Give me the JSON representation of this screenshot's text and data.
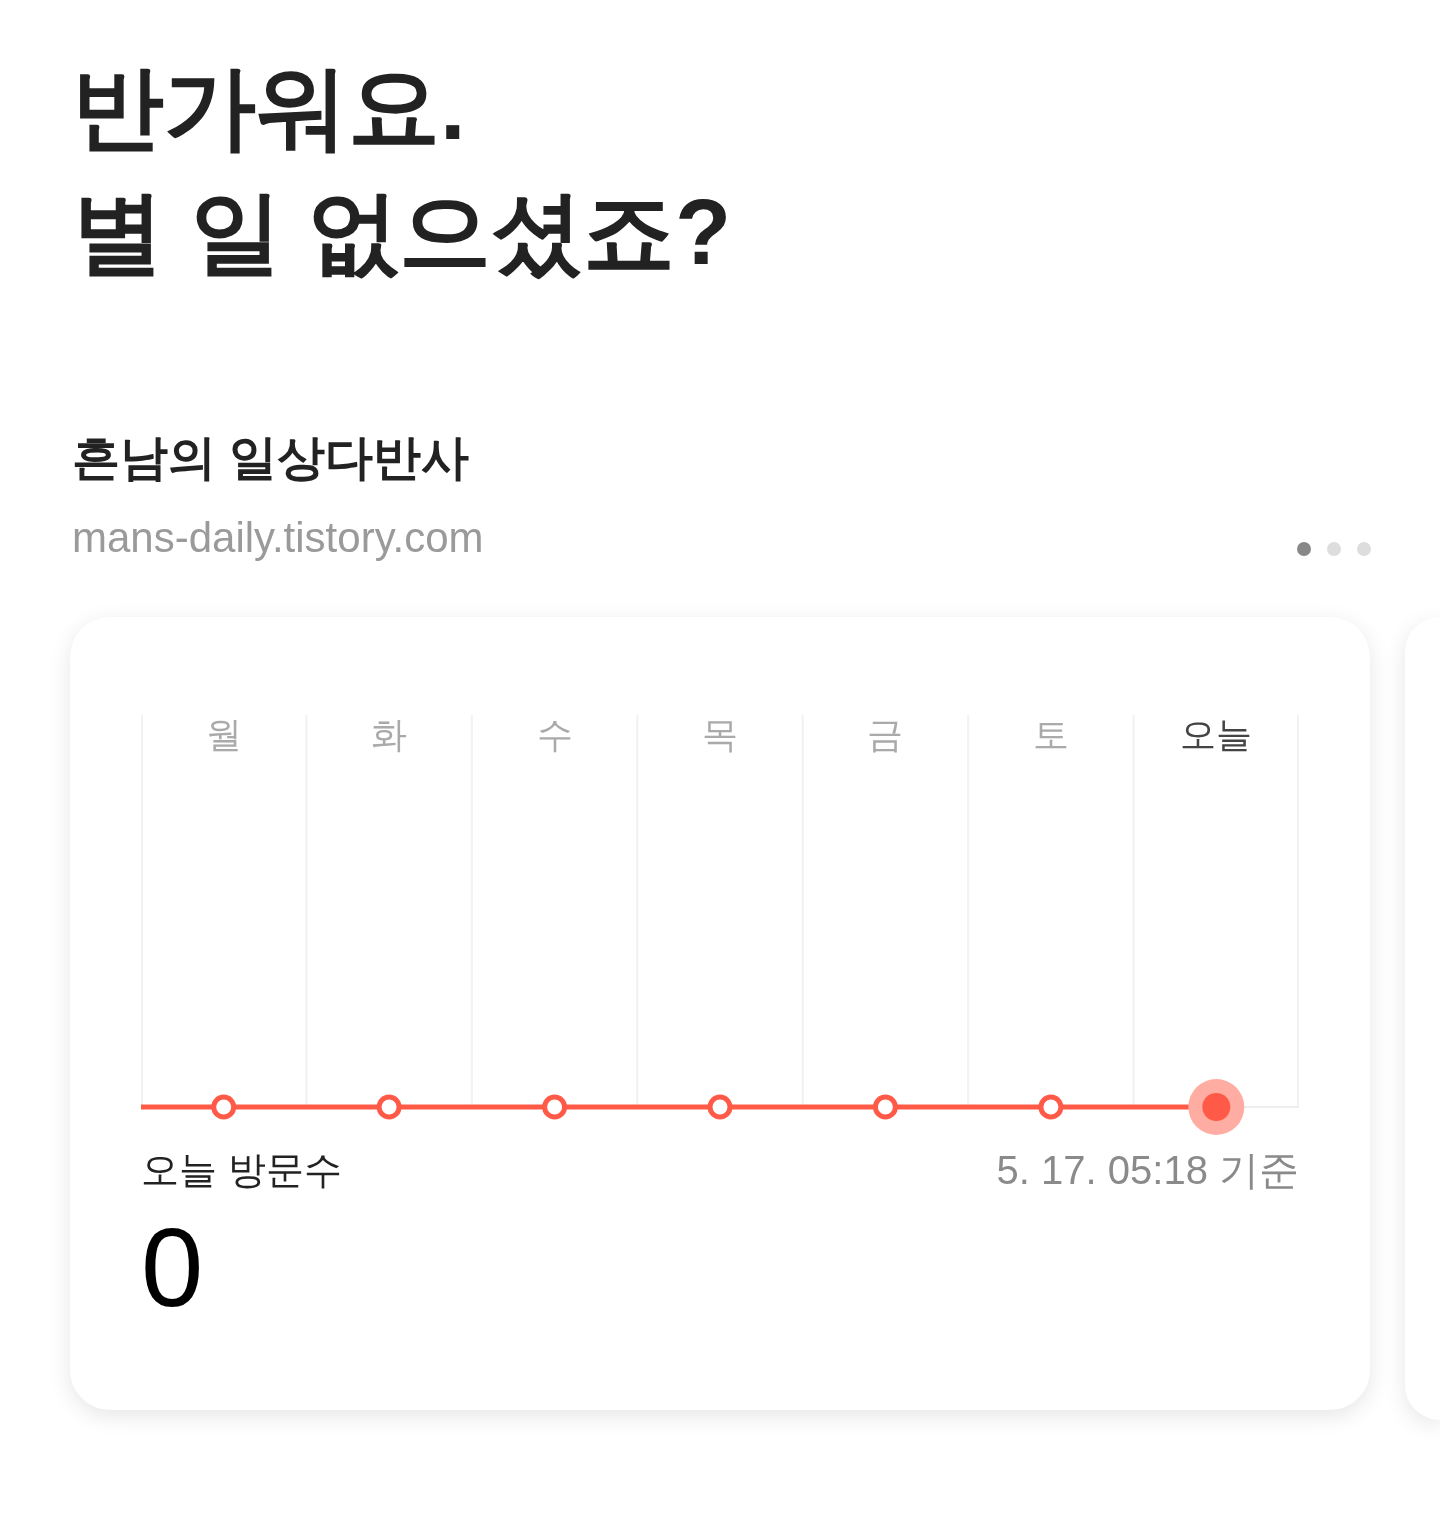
{
  "greeting": "반가워요.\n별 일 없으셨죠?",
  "blog": {
    "title": "흔남의 일상다반사",
    "url": "mans-daily.tistory.com"
  },
  "pager": [
    {
      "selected": true
    },
    {
      "selected": false
    },
    {
      "selected": false
    }
  ],
  "stats_card": {
    "days": [
      {
        "label": "월",
        "selected": false
      },
      {
        "label": "화",
        "selected": false
      },
      {
        "label": "수",
        "selected": false
      },
      {
        "label": "목",
        "selected": false
      },
      {
        "label": "금",
        "selected": false
      },
      {
        "label": "토",
        "selected": false
      },
      {
        "label": "오늘",
        "selected": true
      }
    ],
    "label": "오늘 방문수",
    "timestamp": "5. 17. 05:18 기준",
    "count": "0"
  }
}
